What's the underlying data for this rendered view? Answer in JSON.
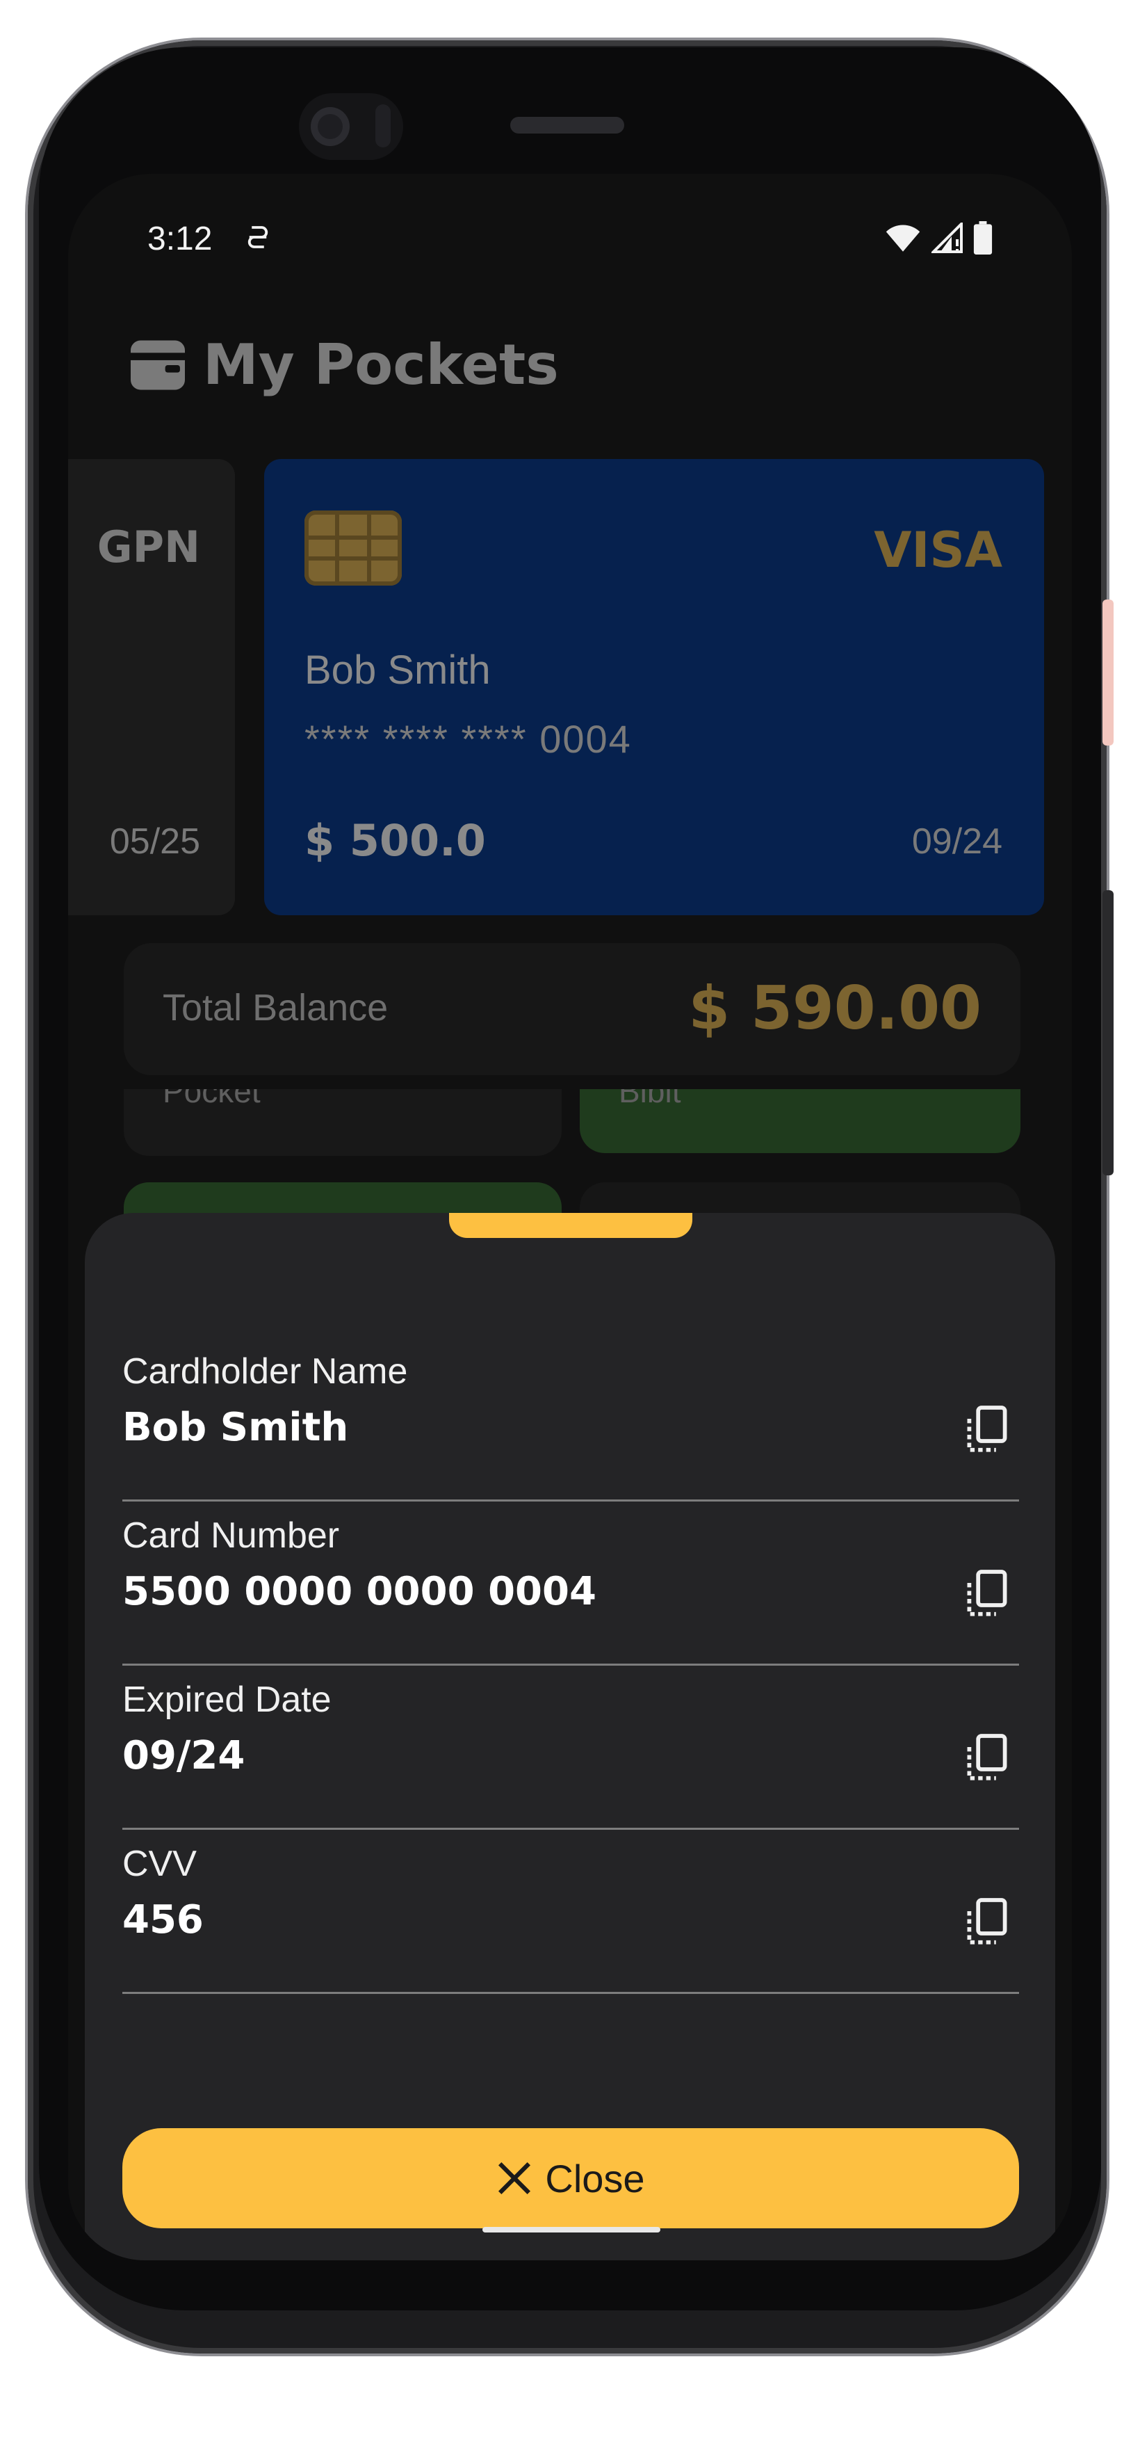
{
  "status_bar": {
    "time": "3:12",
    "notification_icon": "vpn-key-icon",
    "icons": [
      "wifi-icon",
      "cellular-signal-icon",
      "battery-icon"
    ]
  },
  "app": {
    "title": "My Pockets",
    "title_icon": "wallet-icon"
  },
  "cards": [
    {
      "brand": "GPN",
      "expiry": "05/25",
      "color": "#1b1b1b"
    },
    {
      "brand": "VISA",
      "holder": "Bob Smith",
      "masked_number": "**** **** **** 0004",
      "balance": "$ 500.0",
      "expiry": "09/24",
      "color": "#06214e"
    }
  ],
  "total_balance": {
    "label": "Total Balance",
    "value": "$ 590.00"
  },
  "pockets": [
    {
      "label": "Pocket"
    },
    {
      "label": "Bibit"
    }
  ],
  "sheet": {
    "fields": [
      {
        "label": "Cardholder Name",
        "value": "Bob Smith"
      },
      {
        "label": "Card Number",
        "value": "5500 0000 0000 0004"
      },
      {
        "label": "Expired Date",
        "value": "09/24"
      },
      {
        "label": "CVV",
        "value": "456"
      }
    ],
    "close_label": "Close"
  },
  "colors": {
    "accent": "#fdc041",
    "sheet_bg": "#242426",
    "visa_card_bg": "#06214e",
    "pocket_green": "#1f3b1d"
  }
}
